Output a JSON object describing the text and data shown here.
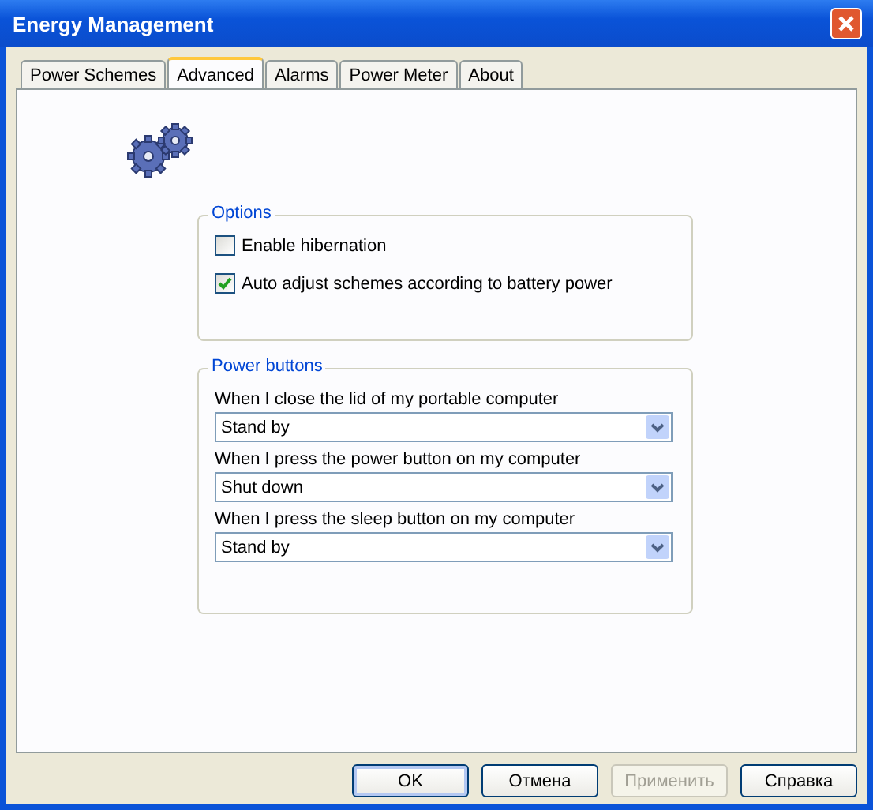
{
  "window": {
    "title": "Energy Management"
  },
  "tabs": [
    {
      "label": "Power Schemes",
      "selected": false
    },
    {
      "label": "Advanced",
      "selected": true
    },
    {
      "label": "Alarms",
      "selected": false
    },
    {
      "label": "Power Meter",
      "selected": false
    },
    {
      "label": "About",
      "selected": false
    }
  ],
  "options": {
    "title": "Options",
    "items": [
      {
        "label": "Enable hibernation",
        "checked": false
      },
      {
        "label": "Auto adjust schemes according to battery power",
        "checked": true
      }
    ]
  },
  "power_buttons": {
    "title": "Power buttons",
    "items": [
      {
        "label": "When I close the lid of my portable computer",
        "value": "Stand by"
      },
      {
        "label": "When I press the power button on my computer",
        "value": "Shut down"
      },
      {
        "label": "When I press the sleep button on my computer",
        "value": "Stand by"
      }
    ]
  },
  "buttons": [
    {
      "label": "OK",
      "disabled": false,
      "default": true
    },
    {
      "label": "Отмена",
      "disabled": false,
      "default": false
    },
    {
      "label": "Применить",
      "disabled": true,
      "default": false
    },
    {
      "label": "Справка",
      "disabled": false,
      "default": false
    }
  ]
}
